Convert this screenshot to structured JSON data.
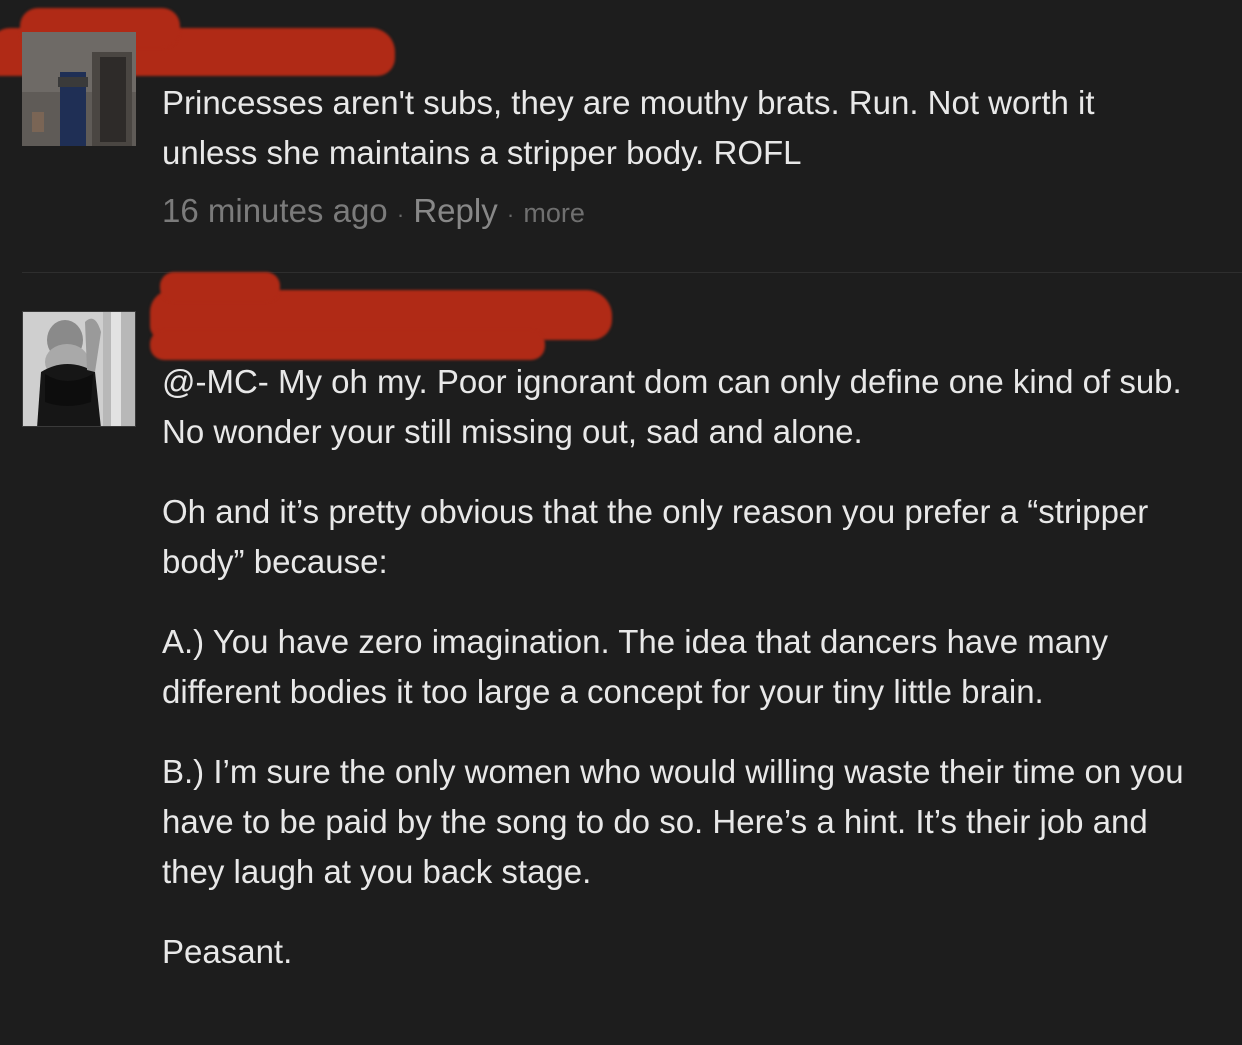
{
  "comment1": {
    "text": "Princesses aren't subs, they are mouthy brats. Run. Not worth it unless she maintains a stripper body. ROFL",
    "timestamp": "16 minutes ago",
    "separator": "·",
    "reply_label": "Reply",
    "more_label": "more"
  },
  "comment2": {
    "paragraphs": [
      "@-MC- My oh my. Poor ignorant dom can only define one kind of sub. No wonder your still missing out, sad and alone.",
      "Oh and it’s pretty obvious that the only reason you prefer a “stripper body” because:",
      "A.) You have zero imagination. The idea that dancers have many different bodies it too large a concept for your tiny little brain.",
      "B.) I’m sure the only women who would willing waste their time on you have to be paid by the song to do so. Here’s a hint. It’s their job and they laugh at you back stage.",
      "Peasant."
    ]
  },
  "colors": {
    "background": "#1d1d1d",
    "text": "#e8e8e8",
    "meta": "#7b7b7b",
    "redaction": "#b02a16"
  }
}
